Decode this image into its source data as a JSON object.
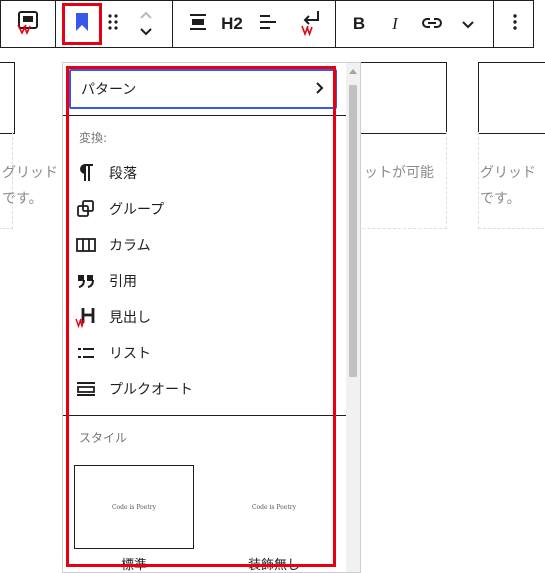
{
  "background": {
    "left_text": "グリッド\nです。",
    "middle_text": "ットが可能",
    "right_text": "グリッド\nです。"
  },
  "toolbar": {
    "transform_icon": "block-transform-icon",
    "bookmark_icon": "bookmark-icon",
    "drag_icon": "drag-handle-icon",
    "heading_label": "H2",
    "bold_label": "B",
    "italic_label": "I",
    "link_icon": "link-icon",
    "more_icon": "chevron-down-icon",
    "options_icon": "more-vertical-icon",
    "highlight_color": "#e60012",
    "accent_color": "#3858e9"
  },
  "dropdown": {
    "pattern_label": "パターン",
    "transform_section": "変換:",
    "items": [
      {
        "label": "段落",
        "icon": "paragraph-icon"
      },
      {
        "label": "グループ",
        "icon": "group-icon"
      },
      {
        "label": "カラム",
        "icon": "columns-icon"
      },
      {
        "label": "引用",
        "icon": "quote-icon"
      },
      {
        "label": "見出し",
        "icon": "heading-icon"
      },
      {
        "label": "リスト",
        "icon": "list-icon"
      },
      {
        "label": "プルクオート",
        "icon": "pullquote-icon"
      }
    ],
    "style_section": "スタイル",
    "styles": [
      {
        "name": "標準",
        "preview": "Code is Poetry"
      },
      {
        "name": "装飾無し",
        "preview": "Code is Poetry"
      }
    ]
  }
}
